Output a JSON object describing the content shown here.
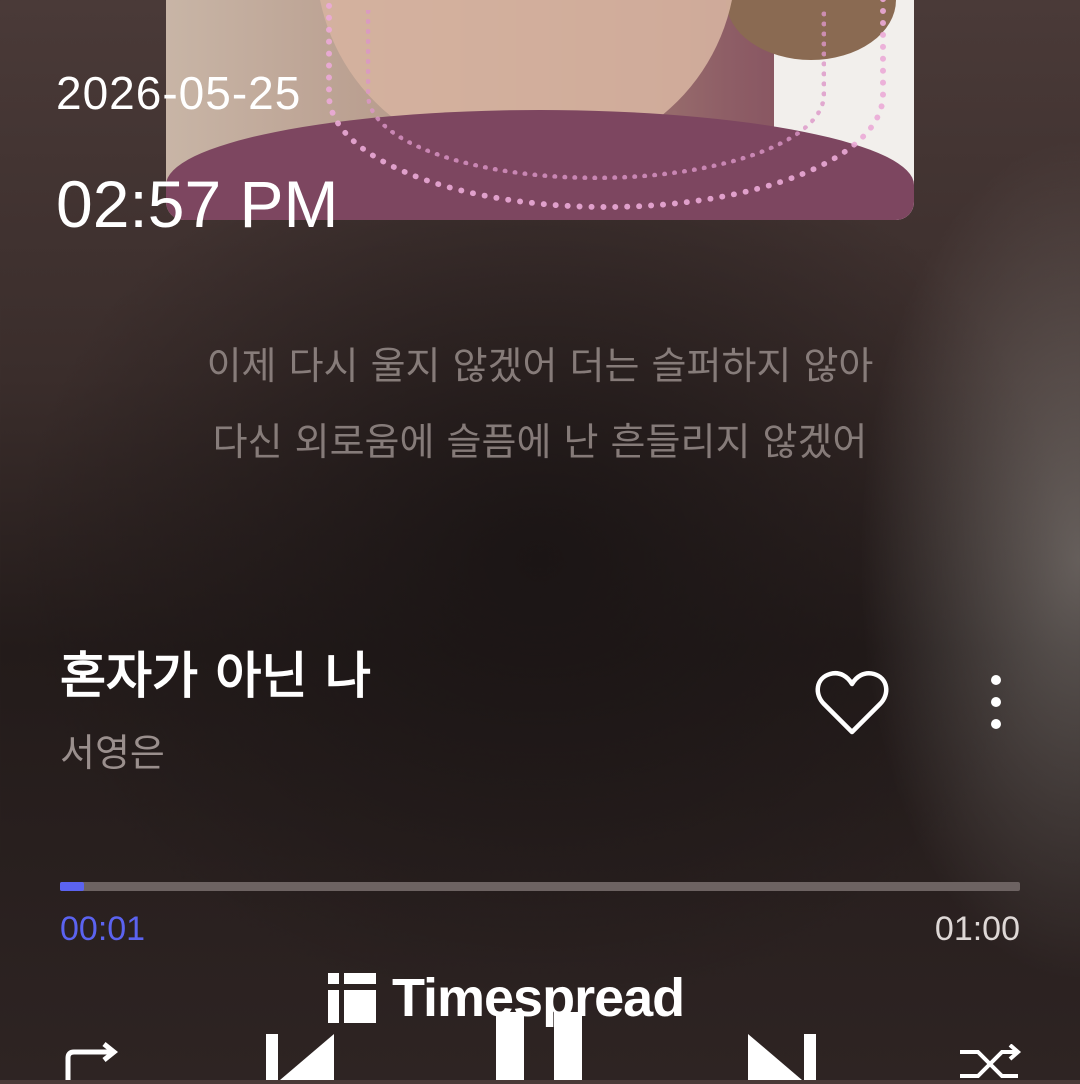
{
  "status": {
    "date": "2026-05-25",
    "time": "02:57 PM"
  },
  "lyrics": {
    "lines": [
      "이제 다시 울지 않겠어 더는 슬퍼하지 않아",
      "다신 외로움에 슬픔에 난 흔들리지 않겠어"
    ]
  },
  "track": {
    "title": "혼자가 아닌 나",
    "artist": "서영은"
  },
  "playback": {
    "elapsed": "00:01",
    "duration": "01:00",
    "progress_fraction": 0.025
  },
  "controls": {
    "icons": [
      "repeat-icon",
      "previous-icon",
      "pause-icon",
      "next-icon",
      "shuffle-icon"
    ]
  },
  "watermark": {
    "text": "Timespread"
  },
  "colors": {
    "accent": "#5b63f0",
    "lyrics": "#968c8a",
    "artist": "#9a8f8d",
    "track_bg": "#6d6362"
  }
}
